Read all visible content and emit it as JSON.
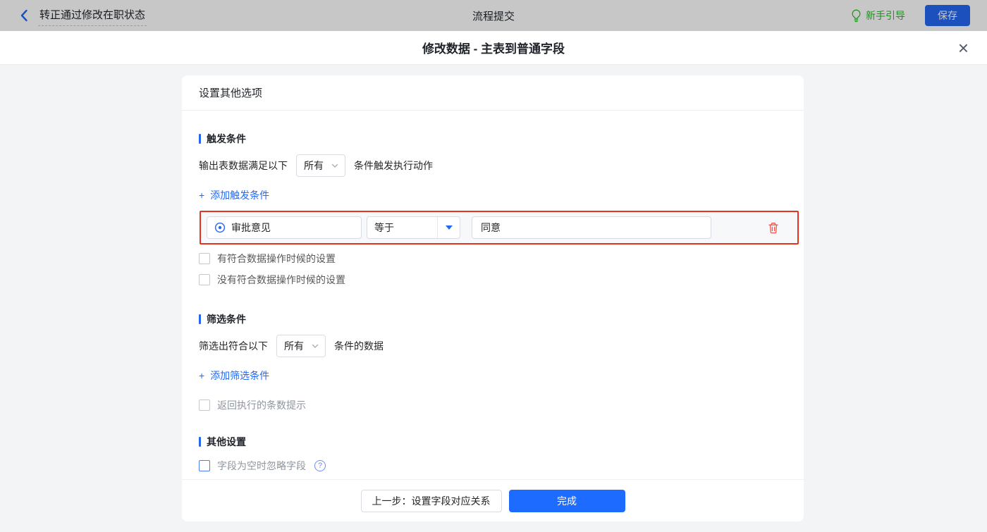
{
  "colors": {
    "accent_blue": "#2468f2",
    "primary_button_blue": "#1e6bff",
    "success_green": "#2eb82e",
    "danger_red": "#e5341d",
    "trash_red": "#f2544a"
  },
  "ui": {
    "plus_glyph": "+",
    "close_glyph": "×",
    "help_glyph": "?"
  },
  "topbar": {
    "back_title": "转正通过修改在职状态",
    "center_title": "流程提交",
    "guide_label": "新手引导",
    "save_label": "保存"
  },
  "modal": {
    "title": "修改数据 - 主表到普通字段"
  },
  "card": {
    "header_title": "设置其他选项",
    "trigger": {
      "title": "触发条件",
      "row_prefix": "输出表数据满足以下",
      "row_select_value": "所有",
      "row_suffix": "条件触发执行动作",
      "add_link": "添加触发条件",
      "condition": {
        "field": "审批意见",
        "operator": "等于",
        "value": "同意"
      },
      "checkboxes": [
        "有符合数据操作时候的设置",
        "没有符合数据操作时候的设置"
      ]
    },
    "filter": {
      "title": "筛选条件",
      "row_prefix": "筛选出符合以下",
      "row_select_value": "所有",
      "row_suffix": "条件的数据",
      "add_link": "添加筛选条件",
      "checkbox_label": "返回执行的条数提示"
    },
    "other": {
      "title": "其他设置",
      "checkbox_label": "字段为空时忽略字段"
    },
    "footer": {
      "prev_label": "上一步：设置字段对应关系",
      "done_label": "完成"
    }
  }
}
